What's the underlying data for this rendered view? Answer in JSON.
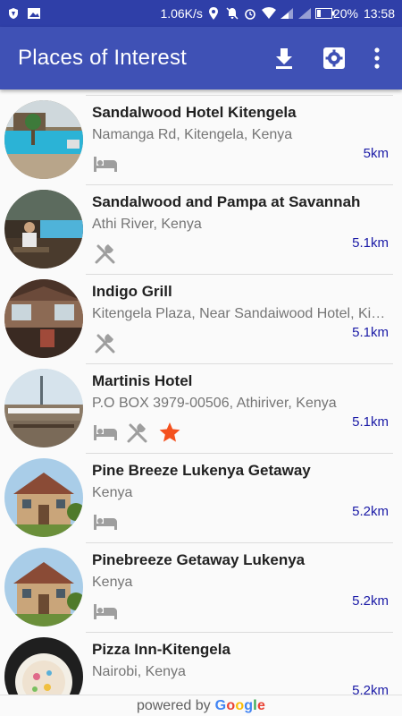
{
  "status_bar": {
    "speed": "1.06K/s",
    "battery": "20%",
    "time": "13:58"
  },
  "app_bar": {
    "title": "Places of Interest",
    "actions": [
      "download-icon",
      "settings-icon",
      "more-vert-icon"
    ]
  },
  "colors": {
    "primary": "#3f51b5",
    "status_bar": "#2f3fa8",
    "distance": "#1a1aa6",
    "star": "#f4511e",
    "icon_gray": "#9e9e9e"
  },
  "places": [
    {
      "name": "Sandalwood Hotel Kitengela",
      "address": "Namanga Rd, Kitengela, Kenya",
      "distance": "5km",
      "icons": [
        "hotel-icon"
      ]
    },
    {
      "name": "Sandalwood and Pampa at Savannah",
      "address": "Athi River, Kenya",
      "distance": "5.1km",
      "icons": [
        "restaurant-icon"
      ]
    },
    {
      "name": "Indigo Grill",
      "address": "Kitengela Plaza, Near Sandaiwood Hotel, Kitengela",
      "distance": "5.1km",
      "icons": [
        "restaurant-icon"
      ]
    },
    {
      "name": "Martinis Hotel",
      "address": "P.O BOX 3979-00506, Athiriver, Kenya",
      "distance": "5.1km",
      "icons": [
        "hotel-icon",
        "restaurant-icon",
        "star-icon"
      ]
    },
    {
      "name": "Pine Breeze Lukenya Getaway",
      "address": "Kenya",
      "distance": "5.2km",
      "icons": [
        "hotel-icon"
      ]
    },
    {
      "name": "Pinebreeze Getaway Lukenya",
      "address": "Kenya",
      "distance": "5.2km",
      "icons": [
        "hotel-icon"
      ]
    },
    {
      "name": "Pizza Inn-Kitengela",
      "address": "Nairobi, Kenya",
      "distance": "5.2km",
      "icons": []
    }
  ],
  "footer": {
    "prefix": "powered by",
    "brand": "Google",
    "brand_colors": [
      "#4285F4",
      "#EA4335",
      "#FBBC05",
      "#4285F4",
      "#34A853",
      "#EA4335"
    ]
  }
}
